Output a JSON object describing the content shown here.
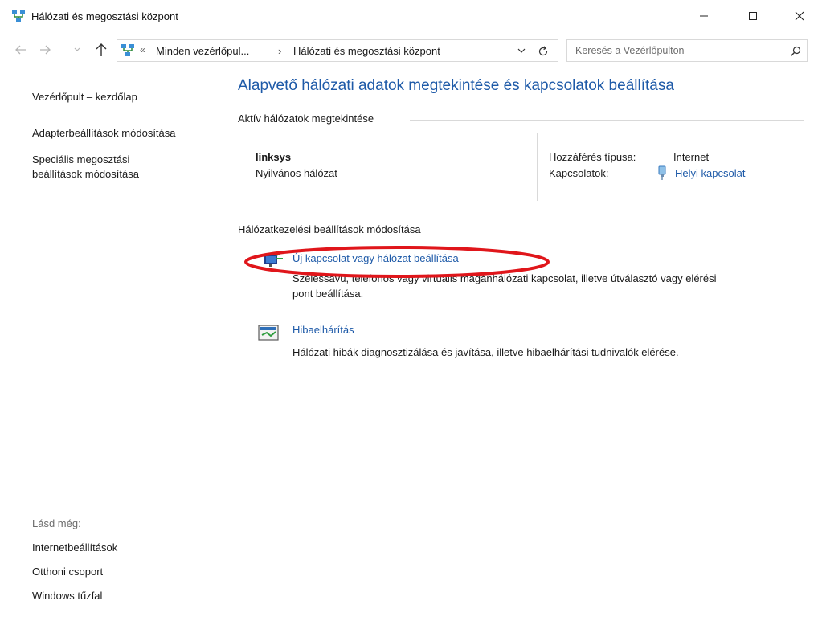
{
  "window": {
    "title": "Hálózati és megosztási központ",
    "icons": [
      "network-icon",
      "minimize-icon",
      "maximize-icon",
      "close-icon"
    ]
  },
  "address_bar": {
    "overflow_chevron": "«",
    "crumb_1": "Minden vezérlőpul...",
    "separator": "›",
    "crumb_2": "Hálózati és megosztási központ",
    "search_placeholder": "Keresés a Vezérlőpulton"
  },
  "sidebar": {
    "home_link": "Vezérlőpult – kezdőlap",
    "adapter_link": "Adapterbeállítások módosítása",
    "sharing_link_line1": "Speciális megosztási",
    "sharing_link_line2": "beállítások módosítása",
    "see_also_label": "Lásd még:",
    "see_also": [
      "Internetbeállítások",
      "Otthoni csoport",
      "Windows tűzfal"
    ]
  },
  "main": {
    "title": "Alapvető hálózati adatok megtekintése és kapcsolatok beállítása",
    "active_networks_header": "Aktív hálózatok megtekintése",
    "network": {
      "name": "linksys",
      "type": "Nyilvános hálózat",
      "access_label": "Hozzáférés típusa:",
      "access_value": "Internet",
      "connections_label": "Kapcsolatok:",
      "connections_value": "Helyi kapcsolat"
    },
    "settings_header": "Hálózatkezelési beállítások módosítása",
    "tasks": [
      {
        "title": "Új kapcsolat vagy hálózat beállítása",
        "description_line1": "Szélessávú, telefonos vagy virtuális magánhálózati kapcsolat, illetve útválasztó vagy elérési",
        "description_line2": "pont beállítása."
      },
      {
        "title": "Hibaelhárítás",
        "description_line1": "Hálózati hibák diagnosztizálása és javítása, illetve hibaelhárítási tudnivalók elérése."
      }
    ]
  },
  "colors": {
    "link_blue": "#1e5aa8",
    "highlight_red": "#e0161b",
    "border_gray": "#d9d9d9"
  }
}
